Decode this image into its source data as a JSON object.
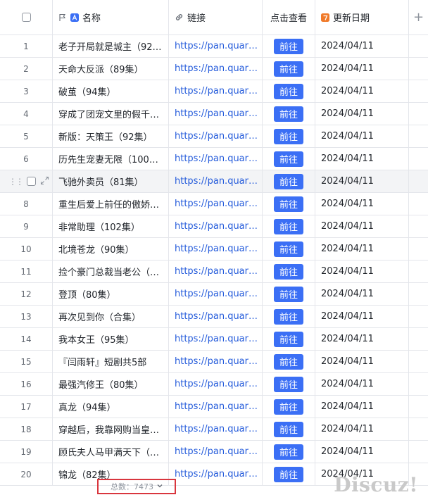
{
  "columns": {
    "name": "名称",
    "link": "链接",
    "view": "点击查看",
    "date": "更新日期"
  },
  "rows": [
    {
      "index": "1",
      "name": "老子开局就是城主（92…",
      "link": "https://pan.quark....",
      "button": "前往",
      "date": "2024/04/11"
    },
    {
      "index": "2",
      "name": "天命大反派（89集）",
      "link": "https://pan.quark....",
      "button": "前往",
      "date": "2024/04/11"
    },
    {
      "index": "3",
      "name": "破茧（94集）",
      "link": "https://pan.quark....",
      "button": "前往",
      "date": "2024/04/11"
    },
    {
      "index": "4",
      "name": "穿成了团宠文里的假千…",
      "link": "https://pan.quark....",
      "button": "前往",
      "date": "2024/04/11"
    },
    {
      "index": "5",
      "name": "新版：天策王（92集）",
      "link": "https://pan.quark....",
      "button": "前往",
      "date": "2024/04/11"
    },
    {
      "index": "6",
      "name": "历先生宠妻无限（100集…",
      "link": "https://pan.quark....",
      "button": "前往",
      "date": "2024/04/11"
    },
    {
      "index": "",
      "name": "飞驰外卖员（81集）",
      "link": "https://pan.quark....",
      "button": "前往",
      "date": "2024/04/11"
    },
    {
      "index": "8",
      "name": "重生后爱上前任的傲娇…",
      "link": "https://pan.quark....",
      "button": "前往",
      "date": "2024/04/11"
    },
    {
      "index": "9",
      "name": "非常助理（102集）",
      "link": "https://pan.quark....",
      "button": "前往",
      "date": "2024/04/11"
    },
    {
      "index": "10",
      "name": "北境苍龙（90集）",
      "link": "https://pan.quark....",
      "button": "前往",
      "date": "2024/04/11"
    },
    {
      "index": "11",
      "name": "捡个豪门总裁当老公（9…",
      "link": "https://pan.quark....",
      "button": "前往",
      "date": "2024/04/11"
    },
    {
      "index": "12",
      "name": "登顶（80集）",
      "link": "https://pan.quark....",
      "button": "前往",
      "date": "2024/04/11"
    },
    {
      "index": "13",
      "name": "再次见到你（合集）",
      "link": "https://pan.quark....",
      "button": "前往",
      "date": "2024/04/11"
    },
    {
      "index": "14",
      "name": "我本女王（95集）",
      "link": "https://pan.quark....",
      "button": "前往",
      "date": "2024/04/11"
    },
    {
      "index": "15",
      "name": "『闫雨轩』短剧共5部",
      "link": "https://pan.quark....",
      "button": "前往",
      "date": "2024/04/11"
    },
    {
      "index": "16",
      "name": "最强汽修王（80集）",
      "link": "https://pan.quark....",
      "button": "前往",
      "date": "2024/04/11"
    },
    {
      "index": "17",
      "name": "真龙（94集）",
      "link": "https://pan.quark....",
      "button": "前往",
      "date": "2024/04/11"
    },
    {
      "index": "18",
      "name": "穿越后，我靠网购当皇…",
      "link": "https://pan.quark....",
      "button": "前往",
      "date": "2024/04/11"
    },
    {
      "index": "19",
      "name": "顾氏夫人马甲满天下（9…",
      "link": "https://pan.quark....",
      "button": "前往",
      "date": "2024/04/11"
    },
    {
      "index": "20",
      "name": "锦龙（82集）",
      "link": "https://pan.quark....",
      "button": "前往",
      "date": "2024/04/11"
    }
  ],
  "hover_row_index": 6,
  "footer": {
    "total_label": "总数：7473"
  },
  "watermark": "Discuz!",
  "colors": {
    "button": "#3b6ff5",
    "link": "#245bdb",
    "highlight_border": "#d9363e"
  },
  "icons": {
    "name_column": [
      "flag-icon",
      "text-type-icon"
    ],
    "link_column": "link-icon",
    "date_column": "date-icon",
    "add_column": "plus-icon",
    "footer": "chevron-down-icon"
  }
}
